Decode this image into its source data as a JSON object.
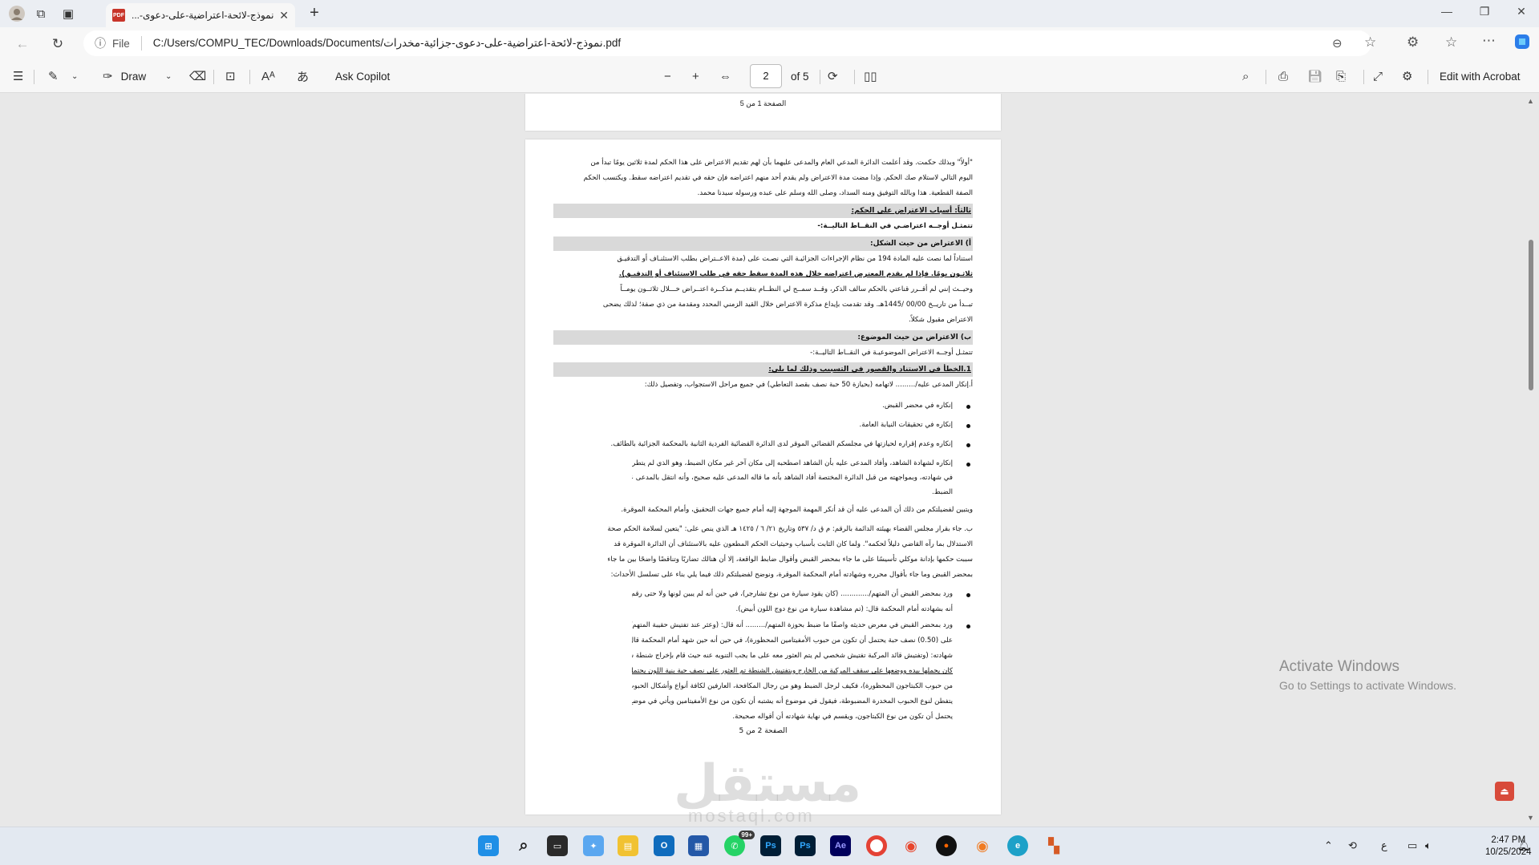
{
  "browser": {
    "tab_title": "نموذج-لائحة-اعتراضية-على-دعوى-...",
    "file_label": "File",
    "url": "C:/Users/COMPU_TEC/Downloads/Documents/نموذج-لائحة-اعتراضية-على-دعوى-جزائية-مخدرات.pdf"
  },
  "pdf_toolbar": {
    "draw_label": "Draw",
    "ask_copilot": "Ask Copilot",
    "page_current": "2",
    "page_total": "of 5",
    "edit_acrobat": "Edit with Acrobat"
  },
  "page1": {
    "footer": "الصفحة 1 من 5"
  },
  "page2": {
    "p1": "\"أولاً\" وبذلك حكمت. وقد أعلمت الدائرة المدعي العام والمدعى عليهما بأن لهم تقديم الاعتراض على هذا الحكم لمدة ثلاثين يومًا تبدأ من",
    "p2": "اليوم التالي لاستلام صك الحكم. وإذا مضت مدة الاعتراض ولم يقدم أحد منهم اعتراضه فإن حقه في تقديم اعتراضه سقط. ويكتسب الحكم",
    "p3": "الصفة القطعية. هذا وبالله التوفيق ومنه السداد، وصلى الله وسلم على عبده ورسوله سيدنا محمد.",
    "h_reasons": "ثالثاً: أسباب الاعتراض على الحكم:",
    "points_intro": "تتمثـل أوجــه اعتراضـي في النقــاط التاليــة:-",
    "h_form": "أ)   الاعتراض من حيث الشكل:",
    "f1": "استناداً لما نصت عليه المادة 194 من نظام الإجراءات الجزائيـة التي نصـت على (مدة الاعــتراض بطلب الاستئنـاف أو التدقيـق",
    "f2": "ثلاثـون يومًا. فإذا لم يقدم المعترض اعتراضه خلال هذه المدة سقط حقه في طلب الاستئناف أو التدقيـق).",
    "f3": "وحيــث إنني لم أقــرر قناعتي بالحكم سالف الذكر، وقــد سمــح لي النظــام بتقديــم مذكــرة اعتــراض خـــلال ثلاثــون يومــاً",
    "f4": "تبــدأ من تاريــخ 00/00 /1445هـ. وقد تقدمت بإيداع مذكرة الاعتراض خلال القيد الزمني المحدد ومقدمة من ذي صفة؛ لذلك يضحى",
    "f5": "الاعتراض مقبول شكلاً.",
    "h_subject": "ب)  الاعتراض من حيث الموضوع:",
    "s_intro": "تتمثـل أوجــه الاعتراض الموضوعيـة في النقــاط التاليــة:-",
    "h_error": "1.الخطأ في الاستناد والقصور في التسبيب وذلك لما يلي:",
    "a1": "أ.إنكار المدعى عليه/......... لاتهامه (بحيازة 50 حبة نصف بقصد التعاطي) في جميع مراحل الاستجواب، وتفصيل ذلك:",
    "b1": "إنكاره في محضر القبض.",
    "b2": "إنكاره في تحقيقات النيابة العامة.",
    "b3": "إنكاره وعدم إقراره لحيازتها في مجلسكم القضائي الموقر لدى الدائرة القضائية الفردية الثانية بالمحكمة الجزائية بالطائف.",
    "b4a": "إنكاره لشهادة الشاهد، وأفاد المدعى عليه بأن الشاهد اصطحبه إلى مكان آخر غير مكان الضبط، وهو الذي لم يتطرق إليه الشاهد",
    "b4b": "في شهادته، وبمواجهته من قبل الدائرة المختصة أفاد الشاهد بأنه ما قاله المدعى عليه صحيح، وأنه انتقل بالمدعى عليه من مكان",
    "b4c": "الضبط.",
    "c1": "ويتبين لفضيلتكم من ذلك أن المدعى عليه أن قد أنكر المهمة الموجهة إليه أمام جميع جهات التحقيق، وأمام المحكمة الموقرة.",
    "d1": "ب. جاء بقرار مجلس القضاء بهيئته الدائمة بالرقم: م ق د/ ٥٣٧ وتاريخ ٢١/ ٦ / ١٤٢٥ هـ الذي ينص على: \"يتعين لسلامة الحكم صحة",
    "d2": "الاستدلال بما رآه القاضي دليلاً لحكمه\". ولما كان الثابت بأسباب وحيثيات الحكم المطعون عليه بالاستئناف أن الدائرة الموقرة قد",
    "d3": "سببت حكمها بإدانة موكلي تأسيسًا على ما جاء بمحضر القبض وأقوال ضابط الواقعة، إلا أن هنالك تضاربًا وتناقضًا واضحًا بين ما جاء",
    "d4": "بمحضر القبض وما جاء بأقوال محرره وشهادته أمام المحكمة الموقرة، ونوضح لفضيلتكم ذلك فيما يلي بناء على تسلسل الأحداث:",
    "e1a": "ورد بمحضر القبض أن المتهم/............. (كان يقود سيارة من نوع تشارجر)، في حين أنه لم يبين لونها ولا حتى رقم لوحتها، في حين",
    "e1b": "أنه بشهادته أمام المحكمة قال: (تم مشاهدة سيارة من نوع دوج اللون أبيض).",
    "e2a": "ورد بمحضر القبض في معرض حديثه واصفًا ما ضبط بحوزة المتهم/......... أنه قال: (وعثر عند تفتيش حقيبة المتهم/ فيصل اليدوية",
    "e2b": "على (0.50) نصف حبة يحتمل أن تكون من حبوب الأمفيتامين المحظورة)، في حين أنه حين شهد أمام المحكمة قال في معرض",
    "e2c": "شهادته: (وتفتيش قائد المركبة تفتيش شخصي لم يتم العثور معه على ما يجب التنويه عنه حيث قام بإخراج شنطة سوداء اللون",
    "e2d": "كان يحملها بيده ووضعها على سقف المركبة من الخارج وبتفتيش الشنطة تم العثور على نصف حبة بنية اللون يحتمل أن تكون",
    "e2e": "من حبوب الكبتاجون المحظورة)، فكيف لرجل الضبط وهو من رجال المكافحة، العارفين لكافة أنواع وأشكال الحبوب المخدرة ألا",
    "e2f": "يتفطن لنوع الحبوب المخدرة المضبوطة، فيقول في موضوع أنه يشتبه أن تكون من نوع الأمفيتامين ويأتي في موضع آخر ويقول أنه",
    "e2g": "يحتمل أن تكون من نوع الكبتاجون، ويقسم في نهاية شهادته أن أقواله صحيحة.",
    "footer": "الصفحة 2 من 5"
  },
  "overlay": {
    "activate_title": "Activate Windows",
    "activate_sub": "Go to Settings to activate Windows.",
    "brand_ar": "مستقل",
    "brand_en": "mostaql.com"
  },
  "taskbar": {
    "whatsapp_badge": "99+",
    "time": "2:47 PM",
    "date": "10/25/2024",
    "lang": "ع"
  }
}
